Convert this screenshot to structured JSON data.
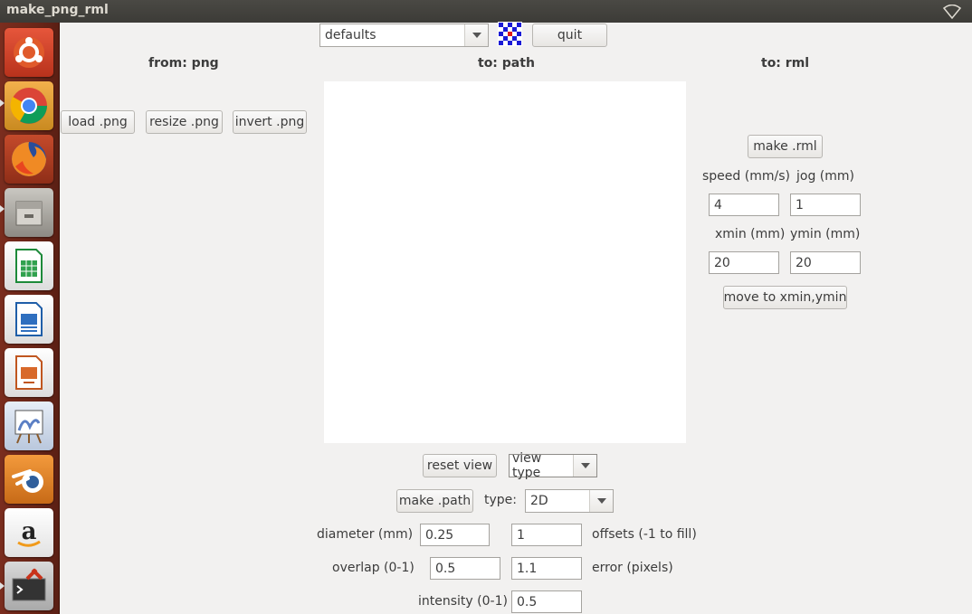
{
  "window": {
    "title": "make_png_rml"
  },
  "launcher": {
    "items": [
      {
        "name": "ubuntu-dash"
      },
      {
        "name": "chromium"
      },
      {
        "name": "firefox"
      },
      {
        "name": "files"
      },
      {
        "name": "libreoffice-calc"
      },
      {
        "name": "libreoffice-writer"
      },
      {
        "name": "libreoffice-impress"
      },
      {
        "name": "drawing-app"
      },
      {
        "name": "blender"
      },
      {
        "name": "amazon"
      },
      {
        "name": "terminal-tools"
      }
    ]
  },
  "toolbar": {
    "defaults_value": "defaults",
    "quit_label": "quit"
  },
  "headers": {
    "from": "from: png",
    "to_path": "to: path",
    "to_rml": "to: rml"
  },
  "png": {
    "load_label": "load .png",
    "resize_label": "resize .png",
    "invert_label": "invert .png"
  },
  "path": {
    "reset_view_label": "reset view",
    "view_type_value": "view type",
    "make_path_label": "make .path",
    "type_label": "type:",
    "type_value": "2D",
    "diameter_label": "diameter (mm)",
    "diameter_value": "0.25",
    "offsets_value": "1",
    "offsets_label": "offsets (-1 to fill)",
    "overlap_label": "overlap (0-1)",
    "overlap_value": "0.5",
    "error_value": "1.1",
    "error_label": "error (pixels)",
    "intensity_label": "intensity (0-1)",
    "intensity_value": "0.5"
  },
  "rml": {
    "make_label": "make .rml",
    "speed_label": "speed (mm/s)",
    "jog_label": "jog (mm)",
    "speed_value": "4",
    "jog_value": "1",
    "xmin_label": "xmin (mm)",
    "ymin_label": "ymin (mm)",
    "xmin_value": "20",
    "ymin_value": "20",
    "move_label": "move to xmin,ymin"
  }
}
